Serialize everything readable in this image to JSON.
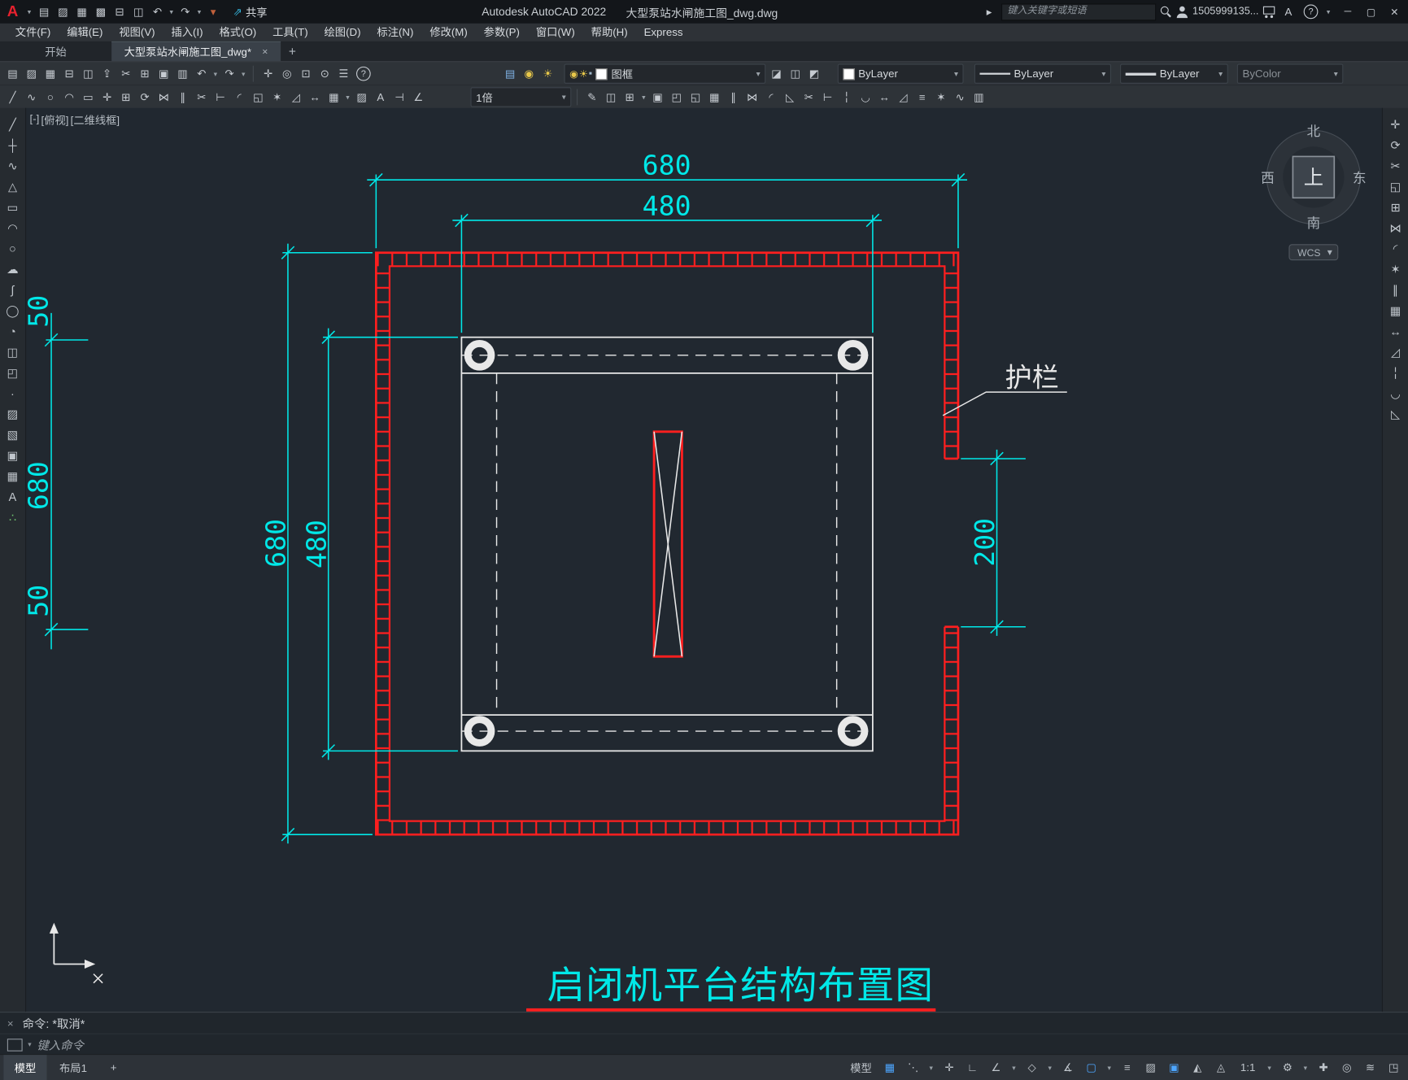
{
  "ui": {
    "caret": "▾"
  },
  "colors": {
    "canvas_bg": "#212830",
    "guardrail_red": "#ff1f1f",
    "dimension_cyan": "#00e8e8",
    "line_white": "#e8e8e8",
    "title_cyan": "#00e8e8"
  },
  "titlebar": {
    "logo": "A",
    "app_title": "Autodesk AutoCAD 2022",
    "doc_title": "大型泵站水闸施工图_dwg.dwg",
    "share_label": "共享",
    "share_glyph": "⇗",
    "search_collapse": "▸",
    "search_placeholder": "键入关键字或短语",
    "user": "1505999135...",
    "apps_glyph": "A",
    "help_glyph": "?",
    "help_caret": "▾",
    "qat": [
      {
        "name": "qnew-icon",
        "glyph": "▤"
      },
      {
        "name": "open-icon",
        "glyph": "▨"
      },
      {
        "name": "qsave-icon",
        "glyph": "▦"
      },
      {
        "name": "save-as-icon",
        "glyph": "▩"
      },
      {
        "name": "plot-icon",
        "glyph": "⊟"
      },
      {
        "name": "batch-plot-icon",
        "glyph": "◫"
      },
      {
        "name": "undo-icon",
        "glyph": "↶",
        "dropdown": true
      },
      {
        "name": "redo-icon",
        "glyph": "↷",
        "dropdown": true
      },
      {
        "name": "qat-customize-icon",
        "glyph": "▾",
        "color": "#c0603b"
      }
    ],
    "window_buttons": [
      {
        "name": "minimize-button",
        "glyph": "─"
      },
      {
        "name": "maximize-button",
        "glyph": "▢"
      },
      {
        "name": "close-button",
        "glyph": "✕"
      }
    ]
  },
  "menubar": {
    "items": [
      {
        "name": "menu-file",
        "label": "文件(F)"
      },
      {
        "name": "menu-edit",
        "label": "编辑(E)"
      },
      {
        "name": "menu-view",
        "label": "视图(V)"
      },
      {
        "name": "menu-insert",
        "label": "插入(I)"
      },
      {
        "name": "menu-format",
        "label": "格式(O)"
      },
      {
        "name": "menu-tools",
        "label": "工具(T)"
      },
      {
        "name": "menu-draw",
        "label": "绘图(D)"
      },
      {
        "name": "menu-dimension",
        "label": "标注(N)"
      },
      {
        "name": "menu-modify",
        "label": "修改(M)"
      },
      {
        "name": "menu-parametric",
        "label": "参数(P)"
      },
      {
        "name": "menu-window",
        "label": "窗口(W)"
      },
      {
        "name": "menu-help",
        "label": "帮助(H)"
      },
      {
        "name": "menu-express",
        "label": "Express"
      }
    ]
  },
  "tabs": {
    "start": "开始",
    "doc": "大型泵站水闸施工图_dwg*",
    "close": "×",
    "new_tab": "+"
  },
  "toolbar1": {
    "icons_file": [
      {
        "name": "qnew-icon",
        "glyph": "▤"
      },
      {
        "name": "open-icon",
        "glyph": "▨"
      },
      {
        "name": "save-icon",
        "glyph": "▦"
      },
      {
        "name": "plot-icon",
        "glyph": "⊟"
      },
      {
        "name": "plot-preview-icon",
        "glyph": "◫"
      },
      {
        "name": "publish-icon",
        "glyph": "⇪"
      },
      {
        "name": "cut-icon",
        "glyph": "✂"
      },
      {
        "name": "copy-icon",
        "glyph": "⊞"
      },
      {
        "name": "paste-icon",
        "glyph": "▣"
      },
      {
        "name": "match-properties-icon",
        "glyph": "▥"
      },
      {
        "name": "undo-icon",
        "glyph": "↶",
        "dropdown": true
      },
      {
        "name": "redo-icon",
        "glyph": "↷",
        "dropdown": true
      }
    ],
    "icons_nav": [
      {
        "name": "pan-icon",
        "glyph": "✛"
      },
      {
        "name": "zoom-realtime-icon",
        "glyph": "◎"
      },
      {
        "name": "zoom-window-icon",
        "glyph": "⊡"
      },
      {
        "name": "zoom-previous-icon",
        "glyph": "⊙"
      },
      {
        "name": "properties-icon",
        "glyph": "☰"
      },
      {
        "name": "help-icon",
        "glyph": "?",
        "cls": "circled"
      }
    ],
    "icons_layer": [
      {
        "name": "layer-properties-icon",
        "glyph": "▤",
        "color": "#7fb2e5"
      },
      {
        "name": "layer-off-icon",
        "glyph": "◉",
        "color": "#e8c84a"
      },
      {
        "name": "layer-freeze-icon",
        "glyph": "☀",
        "color": "#e8c84a"
      }
    ],
    "layer": {
      "icons": [
        {
          "name": "layer-on-icon",
          "glyph": "◉",
          "color": "#e8c84a"
        },
        {
          "name": "layer-thaw-icon",
          "glyph": "☀",
          "color": "#e8c84a"
        },
        {
          "name": "layer-unlock-icon",
          "glyph": "▪",
          "color": "#9fb6c9"
        }
      ],
      "value": "图框"
    },
    "icons_layer2": [
      {
        "name": "make-current-layer-icon",
        "glyph": "◪"
      },
      {
        "name": "layer-match-icon",
        "glyph": "◫"
      },
      {
        "name": "layer-previous-icon",
        "glyph": "◩"
      }
    ],
    "color": "ByLayer",
    "linetype": "ByLayer",
    "lineweight": "ByLayer",
    "plotstyle": "ByColor"
  },
  "toolbar2": {
    "icons_draw": [
      {
        "name": "line-icon",
        "glyph": "╱"
      },
      {
        "name": "polyline-icon",
        "glyph": "∿"
      },
      {
        "name": "circle-icon",
        "glyph": "○"
      },
      {
        "name": "arc-icon",
        "glyph": "◠"
      },
      {
        "name": "rectangle-icon",
        "glyph": "▭"
      },
      {
        "name": "move-icon",
        "glyph": "✛"
      },
      {
        "name": "copy-icon",
        "glyph": "⊞"
      },
      {
        "name": "rotate-icon",
        "glyph": "⟳"
      },
      {
        "name": "mirror-icon",
        "glyph": "⋈"
      },
      {
        "name": "offset-icon",
        "glyph": "∥"
      },
      {
        "name": "trim-icon",
        "glyph": "✂"
      },
      {
        "name": "extend-icon",
        "glyph": "⊢"
      },
      {
        "name": "fillet-icon",
        "glyph": "◜"
      },
      {
        "name": "erase-icon",
        "glyph": "◱"
      },
      {
        "name": "explode-icon",
        "glyph": "✶"
      },
      {
        "name": "scale-icon",
        "glyph": "◿"
      },
      {
        "name": "stretch-icon",
        "glyph": "↔"
      },
      {
        "name": "array-icon",
        "glyph": "▦",
        "dropdown": true
      },
      {
        "name": "hatch-icon",
        "glyph": "▨"
      },
      {
        "name": "text-icon",
        "glyph": "A"
      },
      {
        "name": "dimension-icon",
        "glyph": "⊣"
      },
      {
        "name": "measure-icon",
        "glyph": "∠"
      }
    ],
    "scale_value": "1倍",
    "icons_modify": [
      {
        "name": "linetype-edit-icon",
        "glyph": "✎"
      },
      {
        "name": "block-icon",
        "glyph": "◫"
      },
      {
        "name": "insert-block-icon",
        "glyph": "⊞",
        "dropdown": true
      },
      {
        "name": "wblock-icon",
        "glyph": "▣"
      },
      {
        "name": "group-icon",
        "glyph": "◰"
      },
      {
        "name": "ungroup-icon",
        "glyph": "◱"
      },
      {
        "name": "array-rect-icon",
        "glyph": "▦"
      },
      {
        "name": "offset-icon",
        "glyph": "∥"
      },
      {
        "name": "mirror-icon",
        "glyph": "⋈"
      },
      {
        "name": "fillet-icon",
        "glyph": "◜"
      },
      {
        "name": "chamfer-icon",
        "glyph": "◺"
      },
      {
        "name": "trim-icon",
        "glyph": "✂"
      },
      {
        "name": "extend-icon",
        "glyph": "⊢"
      },
      {
        "name": "break-icon",
        "glyph": "╎"
      },
      {
        "name": "join-icon",
        "glyph": "◡"
      },
      {
        "name": "stretch-icon",
        "glyph": "↔"
      },
      {
        "name": "scale-icon",
        "glyph": "◿"
      },
      {
        "name": "align-icon",
        "glyph": "≡"
      },
      {
        "name": "explode-icon",
        "glyph": "✶"
      },
      {
        "name": "polyline-edit-icon",
        "glyph": "∿"
      },
      {
        "name": "match-properties-icon",
        "glyph": "▥"
      }
    ]
  },
  "left_toolbar": {
    "icons": [
      {
        "name": "line-icon",
        "glyph": "╱"
      },
      {
        "name": "construction-line-icon",
        "glyph": "┼"
      },
      {
        "name": "polyline-icon",
        "glyph": "∿"
      },
      {
        "name": "polygon-icon",
        "glyph": "△"
      },
      {
        "name": "rectangle-icon",
        "glyph": "▭"
      },
      {
        "name": "arc-icon",
        "glyph": "◠"
      },
      {
        "name": "circle-icon",
        "glyph": "○"
      },
      {
        "name": "revision-cloud-icon",
        "glyph": "☁"
      },
      {
        "name": "spline-icon",
        "glyph": "∫"
      },
      {
        "name": "ellipse-icon",
        "glyph": "◯"
      },
      {
        "name": "ellipse-arc-icon",
        "glyph": "◔"
      },
      {
        "name": "insert-block-icon",
        "glyph": "◫"
      },
      {
        "name": "make-block-icon",
        "glyph": "◰"
      },
      {
        "name": "point-icon",
        "glyph": "∙"
      },
      {
        "name": "hatch-icon",
        "glyph": "▨"
      },
      {
        "name": "gradient-icon",
        "glyph": "▧"
      },
      {
        "name": "region-icon",
        "glyph": "▣"
      },
      {
        "name": "table-icon",
        "glyph": "▦"
      },
      {
        "name": "multiline-text-icon",
        "glyph": "A"
      },
      {
        "name": "add-selected-icon",
        "glyph": "∴",
        "color": "#6fc26f"
      }
    ]
  },
  "right_toolbar": {
    "icons": [
      {
        "name": "move-icon",
        "glyph": "✛"
      },
      {
        "name": "rotate-icon",
        "glyph": "⟳"
      },
      {
        "name": "trim-icon",
        "glyph": "✂"
      },
      {
        "name": "erase-icon",
        "glyph": "◱"
      },
      {
        "name": "copy-icon",
        "glyph": "⊞"
      },
      {
        "name": "mirror-icon",
        "glyph": "⋈"
      },
      {
        "name": "fillet-icon",
        "glyph": "◜"
      },
      {
        "name": "explode-icon",
        "glyph": "✶"
      },
      {
        "name": "offset-icon",
        "glyph": "∥"
      },
      {
        "name": "array-icon",
        "glyph": "▦"
      },
      {
        "name": "stretch-icon",
        "glyph": "↔"
      },
      {
        "name": "scale-icon",
        "glyph": "◿"
      },
      {
        "name": "break-icon",
        "glyph": "╎"
      },
      {
        "name": "join-icon",
        "glyph": "◡"
      },
      {
        "name": "chamfer-icon",
        "glyph": "◺"
      }
    ]
  },
  "canvas": {
    "viewport": {
      "minus": "[-]",
      "view": "[俯视]",
      "visual": "[二维线框]"
    },
    "navcube": {
      "north": "北",
      "south": "南",
      "east": "东",
      "west": "西",
      "center": "上",
      "wcs": "WCS",
      "caret": "▾"
    },
    "drawing": {
      "dim_top_outer": "680",
      "dim_top_inner": "480",
      "dim_left_outer": "680",
      "dim_left_inner": "480",
      "dim_right": "200",
      "dim_chain_top": "50",
      "dim_chain_mid": "680",
      "dim_chain_bottom": "50",
      "guardrail_label": "护栏",
      "title": "启闭机平台结构布置图"
    }
  },
  "commandline": {
    "close": "×",
    "history": "命令: *取消*",
    "caret": "▾",
    "prompt": "键入命令"
  },
  "statusbar": {
    "model_tab": "模型",
    "layout_tab": "布局1",
    "plus": "+",
    "right_icons": [
      {
        "name": "model-space-toggle",
        "glyph": "模型",
        "cls": "wide"
      },
      {
        "name": "grid-icon",
        "glyph": "▦",
        "active": true
      },
      {
        "name": "snap-icon",
        "glyph": "⋱",
        "dropdown": true
      },
      {
        "name": "dynamic-input-icon",
        "glyph": "✛"
      },
      {
        "name": "ortho-icon",
        "glyph": "∟"
      },
      {
        "name": "polar-tracking-icon",
        "glyph": "∠",
        "dropdown": true
      },
      {
        "name": "isodraft-icon",
        "glyph": "◇",
        "dropdown": true
      },
      {
        "name": "osnap-tracking-icon",
        "glyph": "∡"
      },
      {
        "name": "osnap-icon",
        "glyph": "▢",
        "active": true,
        "dropdown": true
      },
      {
        "name": "lineweight-icon",
        "glyph": "≡"
      },
      {
        "name": "transparency-icon",
        "glyph": "▨"
      },
      {
        "name": "selection-cycling-icon",
        "glyph": "▣",
        "active": true
      },
      {
        "name": "annotation-visibility-icon",
        "glyph": "◭"
      },
      {
        "name": "annotation-autoscale-icon",
        "glyph": "◬"
      },
      {
        "name": "annotation-scale-label",
        "glyph": "1:1",
        "cls": "wide",
        "dropdown": true
      },
      {
        "name": "workspace-switching-icon",
        "glyph": "⚙",
        "dropdown": true
      },
      {
        "name": "annotation-monitor-icon",
        "glyph": "✚"
      },
      {
        "name": "isolate-objects-icon",
        "glyph": "◎"
      },
      {
        "name": "graphics-performance-icon",
        "glyph": "≋"
      },
      {
        "name": "clean-screen-icon",
        "glyph": "◳"
      }
    ]
  }
}
